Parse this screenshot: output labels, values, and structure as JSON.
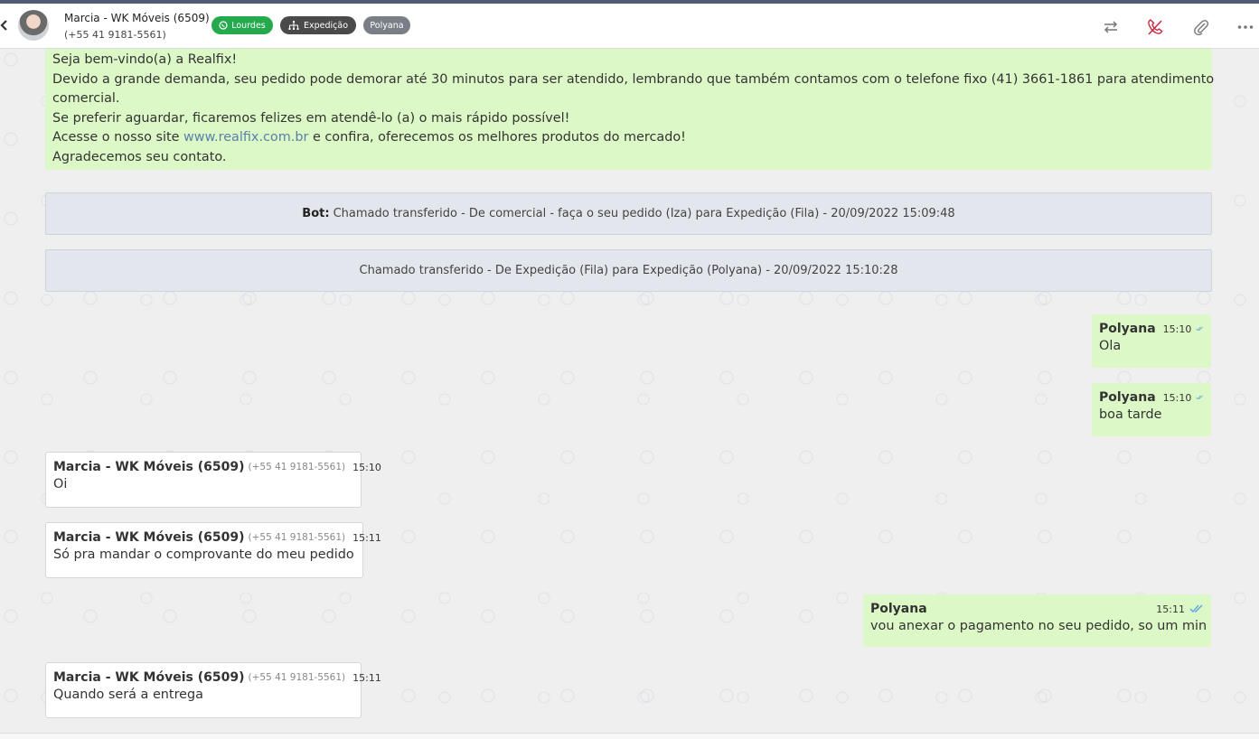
{
  "header": {
    "contact_name": "Marcia - WK Móveis (6509)",
    "contact_phone": "(+55 41 9181-5561)",
    "tags": [
      {
        "label": "Lourdes",
        "color": "#25a94d",
        "icon": "whatsapp-icon"
      },
      {
        "label": "Expedição",
        "color": "#4a4a4a",
        "icon": "sitemap-icon"
      },
      {
        "label": "Polyana",
        "color": "#7a7f87",
        "icon": ""
      }
    ],
    "actions": [
      "transfer-icon",
      "end-call-icon",
      "attach-icon",
      "more-icon"
    ]
  },
  "welcome": {
    "lines": [
      "Seja bem-vindo(a) a Realfix!",
      "Devido a grande demanda, seu pedido pode demorar até 30 minutos para ser atendido, lembrando que também contamos com o telefone fixo (41) 3661-1861 para atendimento",
      "comercial.",
      "Se preferir aguardar, ficaremos felizes em atendê-lo (a) o mais rápido possível!",
      "Acesse o nosso site ",
      "www.realfix.com.br",
      " e confira, oferecemos os melhores produtos do mercado!",
      "Agradecemos seu contato."
    ]
  },
  "system_messages": [
    {
      "prefix": "Bot:",
      "text": "Chamado transferido - De comercial - faça o seu pedido (Iza) para Expedição (Fila) - 20/09/2022 15:09:48"
    },
    {
      "prefix": "",
      "text": "Chamado transferido - De Expedição (Fila) para Expedição (Polyana) - 20/09/2022 15:10:28"
    }
  ],
  "messages": [
    {
      "direction": "out",
      "sender": "Polyana",
      "time": "15:10",
      "text": "Ola"
    },
    {
      "direction": "out",
      "sender": "Polyana",
      "time": "15:10",
      "text": "boa tarde"
    },
    {
      "direction": "in",
      "sender": "Marcia - WK Móveis (6509)",
      "phone": "(+55 41 9181-5561)",
      "time": "15:10",
      "text": "Oi"
    },
    {
      "direction": "in",
      "sender": "Marcia - WK Móveis (6509)",
      "phone": "(+55 41 9181-5561)",
      "time": "15:11",
      "text": "Só pra mandar o comprovante do meu pedido"
    },
    {
      "direction": "out",
      "sender": "Polyana",
      "time": "15:11",
      "text": "vou anexar o pagamento no seu pedido, so um min"
    },
    {
      "direction": "in",
      "sender": "Marcia - WK Móveis (6509)",
      "phone": "(+55 41 9181-5561)",
      "time": "15:11",
      "text": "Quando será a entrega"
    }
  ],
  "colors": {
    "outgoing_bubble": "#dcf8c6",
    "incoming_bubble": "#ffffff",
    "read_check": "#4fa3e0"
  }
}
